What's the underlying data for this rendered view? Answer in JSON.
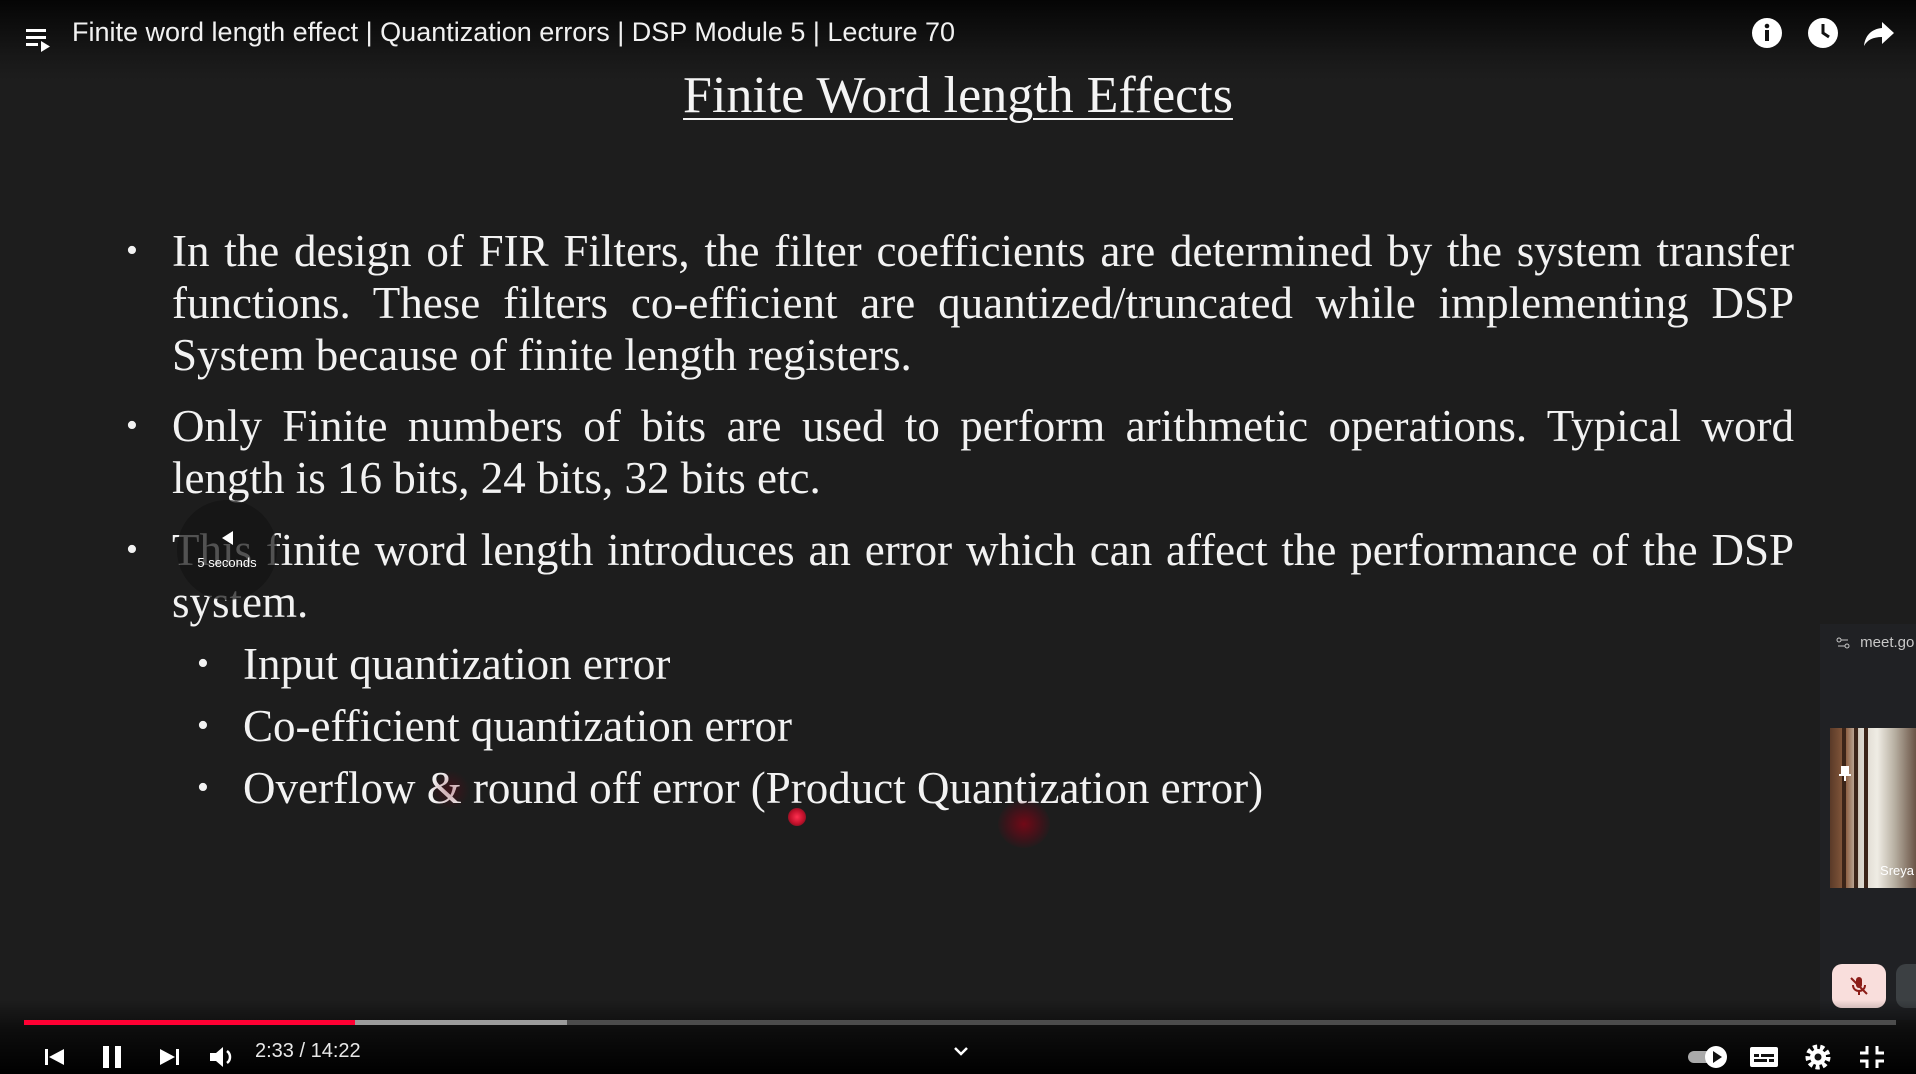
{
  "header": {
    "title": "Finite word length effect | Quantization errors | DSP Module 5 | Lecture 70"
  },
  "slide": {
    "title": "Finite Word length Effects",
    "bullets": [
      "In the design of FIR Filters, the filter coefficients are determined by the system transfer functions. These filters co-efficient are quantized/truncated while implementing DSP System because of finite length registers.",
      "Only Finite numbers of bits are used to perform arithmetic operations. Typical word length is 16 bits, 24 bits, 32 bits etc.",
      "This finite word length introduces an error which can affect the performance of the DSP system."
    ],
    "sub_bullets": [
      "Input quantization error",
      "Co-efficient quantization error",
      "Overflow & round off error (Product Quantization error)"
    ]
  },
  "seek_hint": {
    "label": "5 seconds"
  },
  "meet": {
    "url": "meet.go",
    "participant": "Sreya"
  },
  "player": {
    "current_time": "2:33",
    "separator": " / ",
    "duration": "14:22",
    "played_fraction": 0.177,
    "buffered_fraction": 0.29,
    "accent": "#ff0033"
  },
  "icons": [
    "playlist-icon",
    "info-icon",
    "watch-later-icon",
    "share-icon",
    "prev-icon",
    "pause-icon",
    "next-icon",
    "volume-icon",
    "autoplay-toggle",
    "captions-icon",
    "settings-icon",
    "exit-fullscreen-icon"
  ]
}
